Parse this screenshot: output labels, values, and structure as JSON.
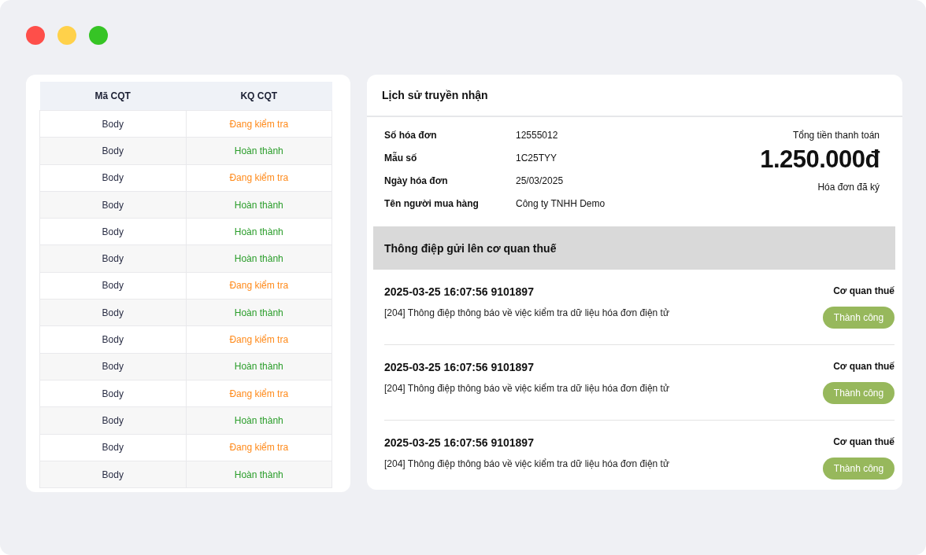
{
  "table": {
    "columns": [
      "Mã CQT",
      "KQ CQT"
    ],
    "rows": [
      {
        "code": "Body",
        "result": {
          "kind": "checking",
          "text": "Đang kiểm tra"
        }
      },
      {
        "code": "Body",
        "result": {
          "kind": "done",
          "text": "Hoàn thành"
        }
      },
      {
        "code": "Body",
        "result": {
          "kind": "checking",
          "text": "Đang kiểm tra"
        }
      },
      {
        "code": "Body",
        "result": {
          "kind": "done",
          "text": "Hoàn thành"
        }
      },
      {
        "code": "Body",
        "result": {
          "kind": "done",
          "text": "Hoàn thành"
        }
      },
      {
        "code": "Body",
        "result": {
          "kind": "done",
          "text": "Hoàn thành"
        }
      },
      {
        "code": "Body",
        "result": {
          "kind": "checking",
          "text": "Đang kiểm tra"
        }
      },
      {
        "code": "Body",
        "result": {
          "kind": "done",
          "text": "Hoàn thành"
        }
      },
      {
        "code": "Body",
        "result": {
          "kind": "checking",
          "text": "Đang kiểm tra"
        }
      },
      {
        "code": "Body",
        "result": {
          "kind": "done",
          "text": "Hoàn thành"
        }
      },
      {
        "code": "Body",
        "result": {
          "kind": "checking",
          "text": "Đang kiểm tra"
        }
      },
      {
        "code": "Body",
        "result": {
          "kind": "done",
          "text": "Hoàn thành"
        }
      },
      {
        "code": "Body",
        "result": {
          "kind": "checking",
          "text": "Đang kiểm tra"
        }
      },
      {
        "code": "Body",
        "result": {
          "kind": "done",
          "text": "Hoàn thành"
        }
      }
    ]
  },
  "history": {
    "title": "Lịch sử truyền nhận",
    "fields": [
      {
        "label": "Số hóa đơn",
        "value": "12555012"
      },
      {
        "label": "Mẫu số",
        "value": "1C25TYY"
      },
      {
        "label": "Ngày hóa đơn",
        "value": "25/03/2025"
      },
      {
        "label": "Tên người mua hàng",
        "value": "Công ty TNHH Demo"
      }
    ],
    "total": {
      "label": "Tổng tiền thanh toán",
      "amount": "1.250.000đ",
      "note": "Hóa đơn đã ký"
    },
    "section_title": "Thông điệp gửi lên cơ quan thuế",
    "messages": [
      {
        "title": "2025-03-25 16:07:56 9101897",
        "description": "[204] Thông điệp thông báo về việc kiểm tra dữ liệu hóa đơn điện tử",
        "source": "Cơ quan thuế",
        "status": "Thành công"
      },
      {
        "title": "2025-03-25 16:07:56 9101897",
        "description": "[204] Thông điệp thông báo về việc kiểm tra dữ liệu hóa đơn điện tử",
        "source": "Cơ quan thuế",
        "status": "Thành công"
      },
      {
        "title": "2025-03-25 16:07:56 9101897",
        "description": "[204] Thông điệp thông báo về việc kiểm tra dữ liệu hóa đơn điện tử",
        "source": "Cơ quan thuế",
        "status": "Thành công"
      }
    ]
  }
}
